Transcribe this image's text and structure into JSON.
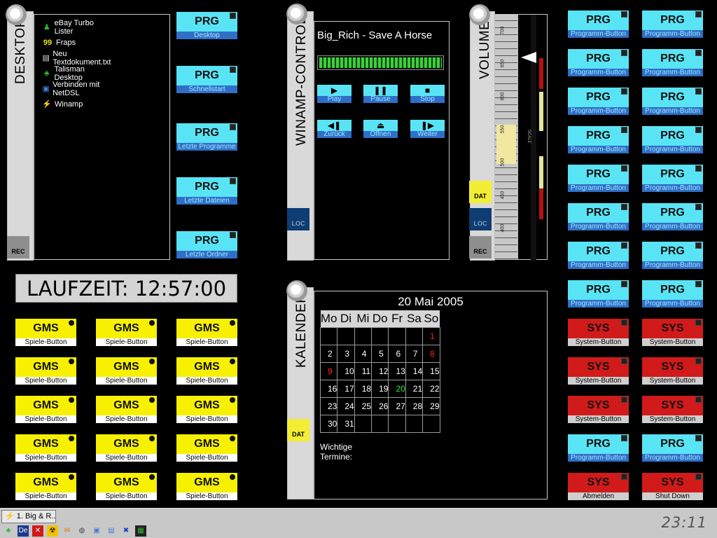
{
  "desktop": {
    "title": "DESKTOP",
    "cap_label": "REC",
    "items": [
      {
        "label": "eBay Turbo Lister",
        "icon": "person-icon"
      },
      {
        "label": "Fraps",
        "icon": "fraps-99-icon",
        "badge": "99"
      },
      {
        "label": "Neu Textdokument.txt",
        "icon": "text-document-icon"
      },
      {
        "label": "Talisman Desktop",
        "icon": "leaf-icon"
      },
      {
        "label": "Verbinden mit NetDSL",
        "icon": "network-connection-icon"
      },
      {
        "label": "Winamp",
        "icon": "winamp-bolt-icon"
      }
    ]
  },
  "shortcuts": [
    {
      "top": "PRG",
      "label": "Desktop"
    },
    {
      "top": "PRG",
      "label": "Schnellstart"
    },
    {
      "top": "PRG",
      "label": "Letzte Programme"
    },
    {
      "top": "PRG",
      "label": "Letzte Dateien"
    },
    {
      "top": "PRG",
      "label": "Letzte Ordner"
    }
  ],
  "laufzeit": "LAUFZEIT: 12:57:00",
  "games": {
    "top": "GMS",
    "label": "Spiele-Button"
  },
  "winamp": {
    "title": "WINAMP-CONTROL",
    "cap_label": "LOC",
    "track": "Big_Rich - Save A Horse",
    "progress": 1.0,
    "buttons": [
      {
        "symbol": "▶",
        "label": "Play"
      },
      {
        "symbol": "❚❚",
        "label": "Pause"
      },
      {
        "symbol": "■",
        "label": "Stop"
      },
      {
        "symbol": "◀❚",
        "label": "Zurück"
      },
      {
        "symbol": "⏏",
        "label": "Öffnen"
      },
      {
        "symbol": "❚▶",
        "label": "Weiter"
      }
    ]
  },
  "volume": {
    "title": "VOLUME",
    "cap_dat": "DAT",
    "cap_loc": "LOC",
    "cap_rec": "REC",
    "scale_labels": [
      "700",
      "650",
      "600",
      "550",
      "500",
      "450",
      "400"
    ],
    "center_label": "SCALE"
  },
  "calendar": {
    "title": "KALENDER",
    "cap_label": "DAT",
    "date_title": "20 Mai 2005",
    "weekdays": [
      "Mo",
      "Di",
      "Mi",
      "Do",
      "Fr",
      "Sa",
      "So"
    ],
    "weeks": [
      [
        "",
        "",
        "",
        "",
        "",
        "",
        "1"
      ],
      [
        "2",
        "3",
        "4",
        "5",
        "6",
        "7",
        "8"
      ],
      [
        "9",
        "10",
        "11",
        "12",
        "13",
        "14",
        "15"
      ],
      [
        "16",
        "17",
        "18",
        "19",
        "20",
        "21",
        "22"
      ],
      [
        "23",
        "24",
        "25",
        "26",
        "27",
        "28",
        "29"
      ],
      [
        "30",
        "31",
        "",
        "",
        "",
        "",
        ""
      ]
    ],
    "red_days": [
      "1",
      "8",
      "9"
    ],
    "today": "20",
    "notes_label": "Wichtige Termine:"
  },
  "right_buttons": {
    "rows": [
      [
        {
          "type": "prg",
          "top": "PRG",
          "label": "Programm-Button"
        },
        {
          "type": "prg",
          "top": "PRG",
          "label": "Programm-Button"
        }
      ],
      [
        {
          "type": "prg",
          "top": "PRG",
          "label": "Programm-Button"
        },
        {
          "type": "prg",
          "top": "PRG",
          "label": "Programm-Button"
        }
      ],
      [
        {
          "type": "prg",
          "top": "PRG",
          "label": "Programm-Button"
        },
        {
          "type": "prg",
          "top": "PRG",
          "label": "Programm-Button"
        }
      ],
      [
        {
          "type": "prg",
          "top": "PRG",
          "label": "Programm-Button"
        },
        {
          "type": "prg",
          "top": "PRG",
          "label": "Programm-Button"
        }
      ],
      [
        {
          "type": "prg",
          "top": "PRG",
          "label": "Programm-Button"
        },
        {
          "type": "prg",
          "top": "PRG",
          "label": "Programm-Button"
        }
      ],
      [
        {
          "type": "prg",
          "top": "PRG",
          "label": "Programm-Button"
        },
        {
          "type": "prg",
          "top": "PRG",
          "label": "Programm-Button"
        }
      ],
      [
        {
          "type": "prg",
          "top": "PRG",
          "label": "Programm-Button"
        },
        {
          "type": "prg",
          "top": "PRG",
          "label": "Programm-Button"
        }
      ],
      [
        {
          "type": "prg",
          "top": "PRG",
          "label": "Programm-Button"
        },
        {
          "type": "prg",
          "top": "PRG",
          "label": "Programm-Button"
        }
      ],
      [
        {
          "type": "sys",
          "top": "SYS",
          "label": "System-Button"
        },
        {
          "type": "sys",
          "top": "SYS",
          "label": "System-Button"
        }
      ],
      [
        {
          "type": "sys",
          "top": "SYS",
          "label": "System-Button"
        },
        {
          "type": "sys",
          "top": "SYS",
          "label": "System-Button"
        }
      ],
      [
        {
          "type": "sys",
          "top": "SYS",
          "label": "System-Button"
        },
        {
          "type": "sys",
          "top": "SYS",
          "label": "System-Button"
        }
      ],
      [
        {
          "type": "prg",
          "top": "PRG",
          "label": "Programm-Button"
        },
        {
          "type": "prg",
          "top": "PRG",
          "label": "Programm-Button"
        }
      ],
      [
        {
          "type": "sys",
          "top": "SYS",
          "label": "Abmelden"
        },
        {
          "type": "sys",
          "top": "SYS",
          "label": "Shut Down"
        }
      ]
    ]
  },
  "taskbar": {
    "task_label": "1. Big & R...",
    "quicklaunch": [
      {
        "icon": "leaf-icon",
        "glyph": "♣"
      },
      {
        "icon": "de-icon",
        "glyph": "De"
      },
      {
        "icon": "flashget-icon",
        "glyph": "✕"
      },
      {
        "icon": "radioactive-icon",
        "glyph": "☢"
      },
      {
        "icon": "mail-icon",
        "glyph": "✉"
      },
      {
        "icon": "globe-icon",
        "glyph": "◍"
      },
      {
        "icon": "network-icon",
        "glyph": "▣"
      },
      {
        "icon": "calendar-icon",
        "glyph": "▤"
      },
      {
        "icon": "cross-icon",
        "glyph": "✖"
      },
      {
        "icon": "grid-icon",
        "glyph": "▦"
      }
    ],
    "clock": "23:11"
  },
  "colors": {
    "prg_face": "#59e4f5",
    "prg_label": "#2f6fc7",
    "sys_face": "#d11a1a",
    "gms_face": "#f7f000",
    "rail": "#d9d9d9"
  }
}
